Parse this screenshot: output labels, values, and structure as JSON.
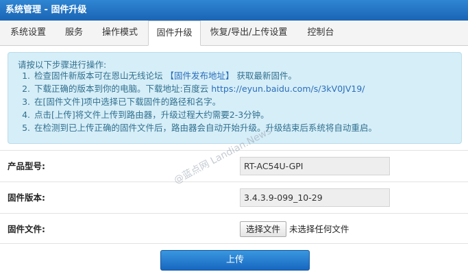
{
  "title": "系统管理 - 固件升级",
  "tabs": [
    {
      "label": "系统设置",
      "active": false
    },
    {
      "label": "服务",
      "active": false
    },
    {
      "label": "操作模式",
      "active": false
    },
    {
      "label": "固件升级",
      "active": true
    },
    {
      "label": "恢复/导出/上传设置",
      "active": false
    },
    {
      "label": "控制台",
      "active": false
    }
  ],
  "instructions": {
    "intro": "请按以下步骤进行操作:",
    "steps": [
      {
        "num": "1.",
        "pre": "检查固件新版本可在恩山无线论坛",
        "link": "【固件发布地址】",
        "post": "获取最新固件。"
      },
      {
        "num": "2.",
        "pre": "下载正确的版本到你的电脑。下载地址:百度云",
        "link": "https://eyun.baidu.com/s/3kV0JV19/",
        "post": ""
      },
      {
        "num": "3.",
        "pre": "在[固件文件]项中选择已下载固件的路径和名字。",
        "link": "",
        "post": ""
      },
      {
        "num": "4.",
        "pre": "点击[上传]将文件上传到路由器，升级过程大约需要2-3分钟。",
        "link": "",
        "post": ""
      },
      {
        "num": "5.",
        "pre": "在检测到已上传正确的固件文件后，路由器会自动开始升级。升级结束后系统将自动重启。",
        "link": "",
        "post": ""
      }
    ]
  },
  "product_model": {
    "label": "产品型号:",
    "value": "RT-AC54U-GPI"
  },
  "firmware_version": {
    "label": "固件版本:",
    "value": "3.4.3.9-099_10-29"
  },
  "firmware_file": {
    "label": "固件文件:",
    "button": "选择文件",
    "status": "未选择任何文件"
  },
  "upload_button": "上传",
  "watermark": "@蓝点网 Landian.News",
  "colors": {
    "title_bar": "#1f6fc3",
    "info_bg": "#d6eef8",
    "info_text": "#31708f",
    "upload_button": "#2180d4"
  }
}
